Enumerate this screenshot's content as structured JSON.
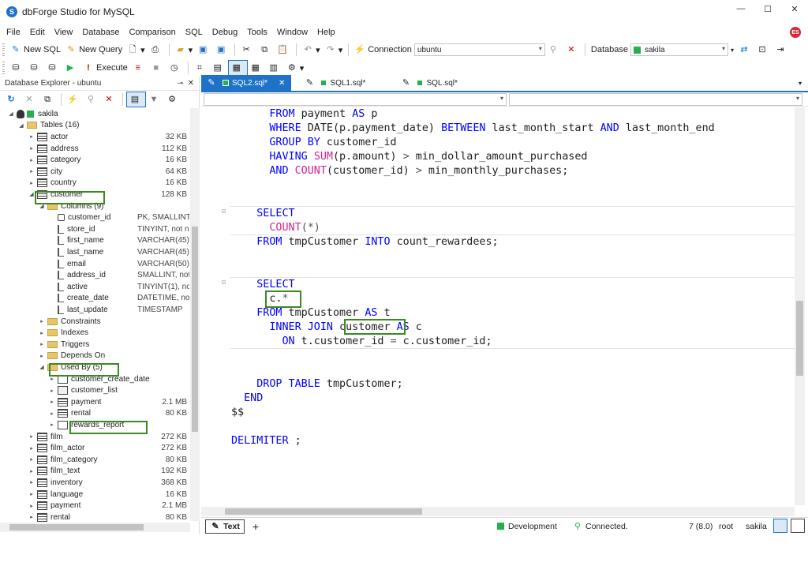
{
  "window": {
    "title": "dbForge Studio for MySQL",
    "user_initials": "ES"
  },
  "menu": [
    "File",
    "Edit",
    "View",
    "Database",
    "Comparison",
    "SQL",
    "Debug",
    "Tools",
    "Window",
    "Help"
  ],
  "toolbar1": {
    "new_sql": "New SQL",
    "new_query": "New Query",
    "connection_label": "Connection",
    "connection_value": "ubuntu",
    "database_label": "Database",
    "database_value": "sakila"
  },
  "toolbar2": {
    "execute": "Execute"
  },
  "explorer": {
    "title": "Database Explorer - ubuntu",
    "rows": [
      {
        "indent": 1,
        "exp": "◢",
        "icon": "db",
        "label": "sakila",
        "size": "",
        "detail": ""
      },
      {
        "indent": 2,
        "exp": "◢",
        "icon": "folder",
        "label": "Tables (16)",
        "size": "",
        "detail": ""
      },
      {
        "indent": 3,
        "exp": "▸",
        "icon": "table",
        "label": "actor",
        "size": "32 KB",
        "detail": ""
      },
      {
        "indent": 3,
        "exp": "▸",
        "icon": "table",
        "label": "address",
        "size": "112 KB",
        "detail": ""
      },
      {
        "indent": 3,
        "exp": "▸",
        "icon": "table",
        "label": "category",
        "size": "16 KB",
        "detail": ""
      },
      {
        "indent": 3,
        "exp": "▸",
        "icon": "table",
        "label": "city",
        "size": "64 KB",
        "detail": ""
      },
      {
        "indent": 3,
        "exp": "▸",
        "icon": "table",
        "label": "country",
        "size": "16 KB",
        "detail": ""
      },
      {
        "indent": 3,
        "exp": "◢",
        "icon": "table",
        "label": "customer",
        "size": "128 KB",
        "detail": ""
      },
      {
        "indent": 4,
        "exp": "◢",
        "icon": "folder",
        "label": "Columns (9)",
        "size": "",
        "detail": ""
      },
      {
        "indent": 5,
        "exp": "",
        "icon": "key",
        "label": "customer_id",
        "size": "",
        "detail": "PK, SMALLINT, r"
      },
      {
        "indent": 5,
        "exp": "",
        "icon": "col",
        "label": "store_id",
        "size": "",
        "detail": "TINYINT, not nu"
      },
      {
        "indent": 5,
        "exp": "",
        "icon": "col",
        "label": "first_name",
        "size": "",
        "detail": "VARCHAR(45), r"
      },
      {
        "indent": 5,
        "exp": "",
        "icon": "col",
        "label": "last_name",
        "size": "",
        "detail": "VARCHAR(45), r"
      },
      {
        "indent": 5,
        "exp": "",
        "icon": "col",
        "label": "email",
        "size": "",
        "detail": "VARCHAR(50)"
      },
      {
        "indent": 5,
        "exp": "",
        "icon": "col",
        "label": "address_id",
        "size": "",
        "detail": "SMALLINT, not r"
      },
      {
        "indent": 5,
        "exp": "",
        "icon": "col",
        "label": "active",
        "size": "",
        "detail": "TINYINT(1), not"
      },
      {
        "indent": 5,
        "exp": "",
        "icon": "col",
        "label": "create_date",
        "size": "",
        "detail": "DATETIME, not"
      },
      {
        "indent": 5,
        "exp": "",
        "icon": "col",
        "label": "last_update",
        "size": "",
        "detail": "TIMESTAMP"
      },
      {
        "indent": 4,
        "exp": "▸",
        "icon": "folder",
        "label": "Constraints",
        "size": "",
        "detail": ""
      },
      {
        "indent": 4,
        "exp": "▸",
        "icon": "folder",
        "label": "Indexes",
        "size": "",
        "detail": ""
      },
      {
        "indent": 4,
        "exp": "▸",
        "icon": "folder",
        "label": "Triggers",
        "size": "",
        "detail": ""
      },
      {
        "indent": 4,
        "exp": "▸",
        "icon": "folder",
        "label": "Depends On",
        "size": "",
        "detail": ""
      },
      {
        "indent": 4,
        "exp": "◢",
        "icon": "folder",
        "label": "Used By (5)",
        "size": "",
        "detail": ""
      },
      {
        "indent": 5,
        "exp": "▸",
        "icon": "proc",
        "label": "customer_create_date",
        "size": "",
        "detail": ""
      },
      {
        "indent": 5,
        "exp": "▸",
        "icon": "view",
        "label": "customer_list",
        "size": "",
        "detail": ""
      },
      {
        "indent": 5,
        "exp": "▸",
        "icon": "table",
        "label": "payment",
        "size": "2.1 MB",
        "detail": ""
      },
      {
        "indent": 5,
        "exp": "▸",
        "icon": "table",
        "label": "rental",
        "size": "80 KB",
        "detail": ""
      },
      {
        "indent": 5,
        "exp": "▸",
        "icon": "proc",
        "label": "rewards_report",
        "size": "",
        "detail": ""
      },
      {
        "indent": 3,
        "exp": "▸",
        "icon": "table",
        "label": "film",
        "size": "272 KB",
        "detail": ""
      },
      {
        "indent": 3,
        "exp": "▸",
        "icon": "table",
        "label": "film_actor",
        "size": "272 KB",
        "detail": ""
      },
      {
        "indent": 3,
        "exp": "▸",
        "icon": "table",
        "label": "film_category",
        "size": "80 KB",
        "detail": ""
      },
      {
        "indent": 3,
        "exp": "▸",
        "icon": "table",
        "label": "film_text",
        "size": "192 KB",
        "detail": ""
      },
      {
        "indent": 3,
        "exp": "▸",
        "icon": "table",
        "label": "inventory",
        "size": "368 KB",
        "detail": ""
      },
      {
        "indent": 3,
        "exp": "▸",
        "icon": "table",
        "label": "language",
        "size": "16 KB",
        "detail": ""
      },
      {
        "indent": 3,
        "exp": "▸",
        "icon": "table",
        "label": "payment",
        "size": "2.1 MB",
        "detail": ""
      },
      {
        "indent": 3,
        "exp": "▸",
        "icon": "table",
        "label": "rental",
        "size": "80 KB",
        "detail": ""
      }
    ]
  },
  "tabs": [
    {
      "label": "SQL2.sql*",
      "active": true
    },
    {
      "label": "SQL1.sql*",
      "active": false
    },
    {
      "label": "SQL.sql*",
      "active": false
    }
  ],
  "code_lines": [
    [
      {
        "t": "      "
      },
      {
        "t": "FROM",
        "c": "kw"
      },
      {
        "t": " payment "
      },
      {
        "t": "AS",
        "c": "kw"
      },
      {
        "t": " p"
      }
    ],
    [
      {
        "t": "      "
      },
      {
        "t": "WHERE",
        "c": "kw"
      },
      {
        "t": " DATE(p.payment_date) "
      },
      {
        "t": "BETWEEN",
        "c": "kw"
      },
      {
        "t": " last_month_start "
      },
      {
        "t": "AND",
        "c": "kw"
      },
      {
        "t": " last_month_end"
      }
    ],
    [
      {
        "t": "      "
      },
      {
        "t": "GROUP BY",
        "c": "kw"
      },
      {
        "t": " customer_id"
      }
    ],
    [
      {
        "t": "      "
      },
      {
        "t": "HAVING",
        "c": "kw"
      },
      {
        "t": " "
      },
      {
        "t": "SUM",
        "c": "fn"
      },
      {
        "t": "(p.amount) "
      },
      {
        "t": ">",
        "c": "op"
      },
      {
        "t": " min_dollar_amount_purchased"
      }
    ],
    [
      {
        "t": "      "
      },
      {
        "t": "AND",
        "c": "kw"
      },
      {
        "t": " "
      },
      {
        "t": "COUNT",
        "c": "fn"
      },
      {
        "t": "(customer_id) "
      },
      {
        "t": ">",
        "c": "op"
      },
      {
        "t": " min_monthly_purchases;"
      }
    ],
    [],
    [],
    [
      {
        "t": "    "
      },
      {
        "t": "SELECT",
        "c": "kw"
      }
    ],
    [
      {
        "t": "      "
      },
      {
        "t": "COUNT",
        "c": "fn"
      },
      {
        "t": "(*)",
        "c": "op"
      }
    ],
    [
      {
        "t": "    "
      },
      {
        "t": "FROM",
        "c": "kw"
      },
      {
        "t": " tmpCustomer "
      },
      {
        "t": "INTO",
        "c": "kw"
      },
      {
        "t": " count_rewardees;"
      }
    ],
    [],
    [],
    [
      {
        "t": "    "
      },
      {
        "t": "SELECT",
        "c": "kw"
      }
    ],
    [
      {
        "t": "      c."
      },
      {
        "t": "*",
        "c": "op"
      }
    ],
    [
      {
        "t": "    "
      },
      {
        "t": "FROM",
        "c": "kw"
      },
      {
        "t": " tmpCustomer "
      },
      {
        "t": "AS",
        "c": "kw"
      },
      {
        "t": " t"
      }
    ],
    [
      {
        "t": "      "
      },
      {
        "t": "INNER JOIN",
        "c": "kw"
      },
      {
        "t": " customer "
      },
      {
        "t": "AS",
        "c": "kw"
      },
      {
        "t": " c"
      }
    ],
    [
      {
        "t": "        "
      },
      {
        "t": "ON",
        "c": "kw"
      },
      {
        "t": " t.customer_id "
      },
      {
        "t": "=",
        "c": "op"
      },
      {
        "t": " c.customer_id;"
      }
    ],
    [],
    [],
    [
      {
        "t": "    "
      },
      {
        "t": "DROP TABLE",
        "c": "kw"
      },
      {
        "t": " tmpCustomer;"
      }
    ],
    [
      {
        "t": "  "
      },
      {
        "t": "END",
        "c": "kw"
      }
    ],
    [
      {
        "t": "$$"
      }
    ],
    [],
    [
      {
        "t": "DELIMITER",
        "c": "kw"
      },
      {
        "t": " ;"
      }
    ]
  ],
  "status": {
    "text_tab": "Text",
    "environment": "Development",
    "connection": "Connected.",
    "position": "7 (8.0)",
    "user": "root",
    "database": "sakila"
  },
  "colors": {
    "accent": "#1e73c8",
    "highlight_box": "#3a8a1f",
    "keyword": "#0000ff",
    "function": "#d4228e"
  }
}
